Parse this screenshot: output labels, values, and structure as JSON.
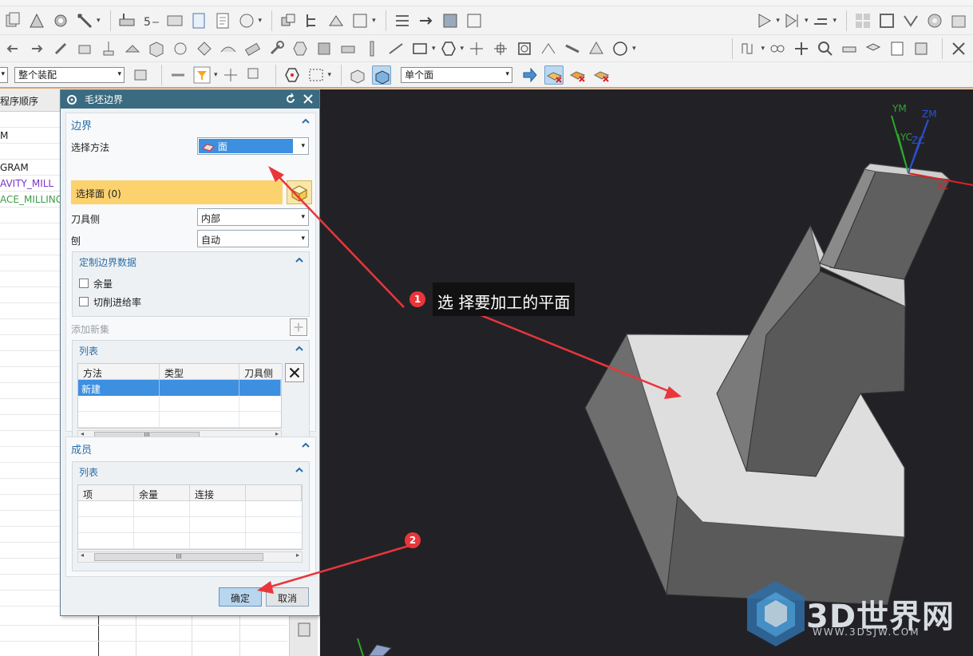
{
  "toolbar": {
    "filter_assembly": "整个装配",
    "face_rule": "单个面"
  },
  "navigator": {
    "header": "程序顺序",
    "rows": [
      "",
      "M",
      "",
      "GRAM",
      "AVITY_MILL",
      "ACE_MILLING"
    ]
  },
  "dialog": {
    "title": "毛坯边界",
    "boundary": {
      "header": "边界",
      "select_method_label": "选择方法",
      "select_method_value": "面",
      "select_face_label": "选择面 (0)",
      "tool_side_label": "刀具侧",
      "tool_side_value": "内部",
      "plane_label": "刨",
      "plane_value": "自动",
      "custom_header": "定制边界数据",
      "stock_label": "余量",
      "feed_label": "切削进给率",
      "add_new_set": "添加新集",
      "list_header": "列表",
      "list_columns": [
        "方法",
        "类型",
        "刀具侧"
      ],
      "list_rows": [
        [
          "新建",
          "",
          ""
        ]
      ]
    },
    "members": {
      "header": "成员",
      "list_header": "列表",
      "list_columns": [
        "项",
        "余量",
        "连接"
      ]
    },
    "ok_label": "确定",
    "cancel_label": "取消"
  },
  "viewport": {
    "axis_labels": {
      "ym": "YM",
      "yc": "YC",
      "zm": "ZM",
      "zc": "ZC",
      "xc": "XC"
    }
  },
  "annotation": {
    "badge1": "1",
    "badge2": "2",
    "text": "选 择要加工的平面"
  },
  "watermark": {
    "brand": "3D世界网",
    "url": "WWW.3DSJW.COM"
  },
  "colors": {
    "title_bar": "#3a6b80",
    "highlight": "#fcd26f",
    "selection": "#3d8fe0",
    "annotation_red": "#e8363b",
    "viewport_bg": "#222226"
  }
}
